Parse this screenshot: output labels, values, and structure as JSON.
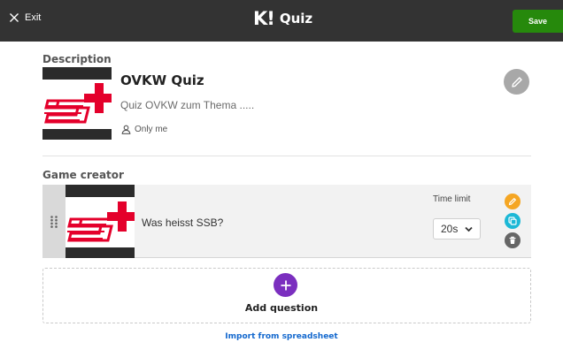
{
  "topbar": {
    "exit_label": "Exit",
    "brand_mark": "K!",
    "brand_name": "Quiz",
    "save_label": "Save",
    "save_color": "#26890c",
    "background_color": "#333333"
  },
  "description": {
    "section_title": "Description",
    "quiz_title": "OVKW Quiz",
    "quiz_description": "Quiz OVKW zum Thema .....",
    "visibility": "Only me",
    "cover_logo_text": "S+"
  },
  "game_creator": {
    "section_title": "Game creator",
    "questions": [
      {
        "text": "Was heisst SSB?",
        "time_limit_label": "Time limit",
        "time_limit_value": "20s",
        "actions": [
          "edit-icon",
          "duplicate-icon",
          "trash-icon"
        ]
      }
    ],
    "add_question_label": "Add question",
    "import_label": "Import from spreadsheet"
  },
  "colors": {
    "accent_purple": "#7b2fbf",
    "link_blue": "#1368ce",
    "edit_orange": "#f5a623",
    "duplicate_cyan": "#1cb8d6",
    "delete_gray": "#666666",
    "logo_red": "#e4002b"
  }
}
